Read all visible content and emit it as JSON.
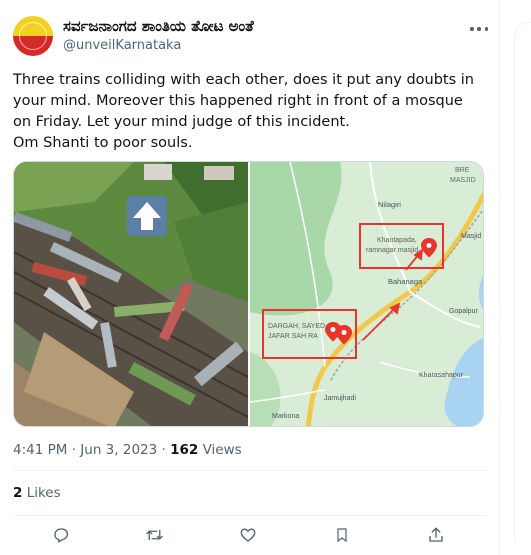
{
  "author": {
    "display_name": "ಸರ್ವಜನಾಂಗದ ಶಾಂತಿಯ ತೋಟ ಅಂತೆ",
    "handle": "@unveilKarnataka",
    "avatar_colors": [
      "#f2d21e",
      "#d62a2a"
    ]
  },
  "tweet": {
    "lines": [
      "Three trains colliding with each other, does it put any doubts in your mind. Moreover this happened right in front of a mosque on Friday. Let your mind judge of this incident.",
      "Om Shanti to poor souls."
    ],
    "time": "4:41 PM",
    "separator": "·",
    "date": "Jun 3, 2023",
    "views_count": "162",
    "views_label": "Views",
    "likes_count": "2",
    "likes_label": "Likes"
  },
  "map": {
    "labels": {
      "masjid_top": "MASJID",
      "bre": "BRE",
      "nilagiri": "Nilagiri",
      "masjid_right": "Masjid",
      "khantapada_1": "Khantapada,",
      "khantapada_2": "ramnagar masjid",
      "bahanaga": "Bahanaga",
      "gopalpur": "Gopalpur",
      "dargah_1": "DARGAH, SAYED",
      "dargah_2": "JAFAR SAH RA",
      "kharasahapur": "Kharasahapur",
      "jamujhadi": "Jamujhadi",
      "markona": "Markona"
    },
    "highlight_color": "#e8352b",
    "land_color": "#c6e6c8",
    "water_color": "#a8d4f2",
    "road_color": "#f1c84a"
  },
  "actions": {
    "icons": [
      "reply-icon",
      "retweet-icon",
      "like-icon",
      "bookmark-icon",
      "share-icon"
    ],
    "icon_color": "#536471"
  }
}
